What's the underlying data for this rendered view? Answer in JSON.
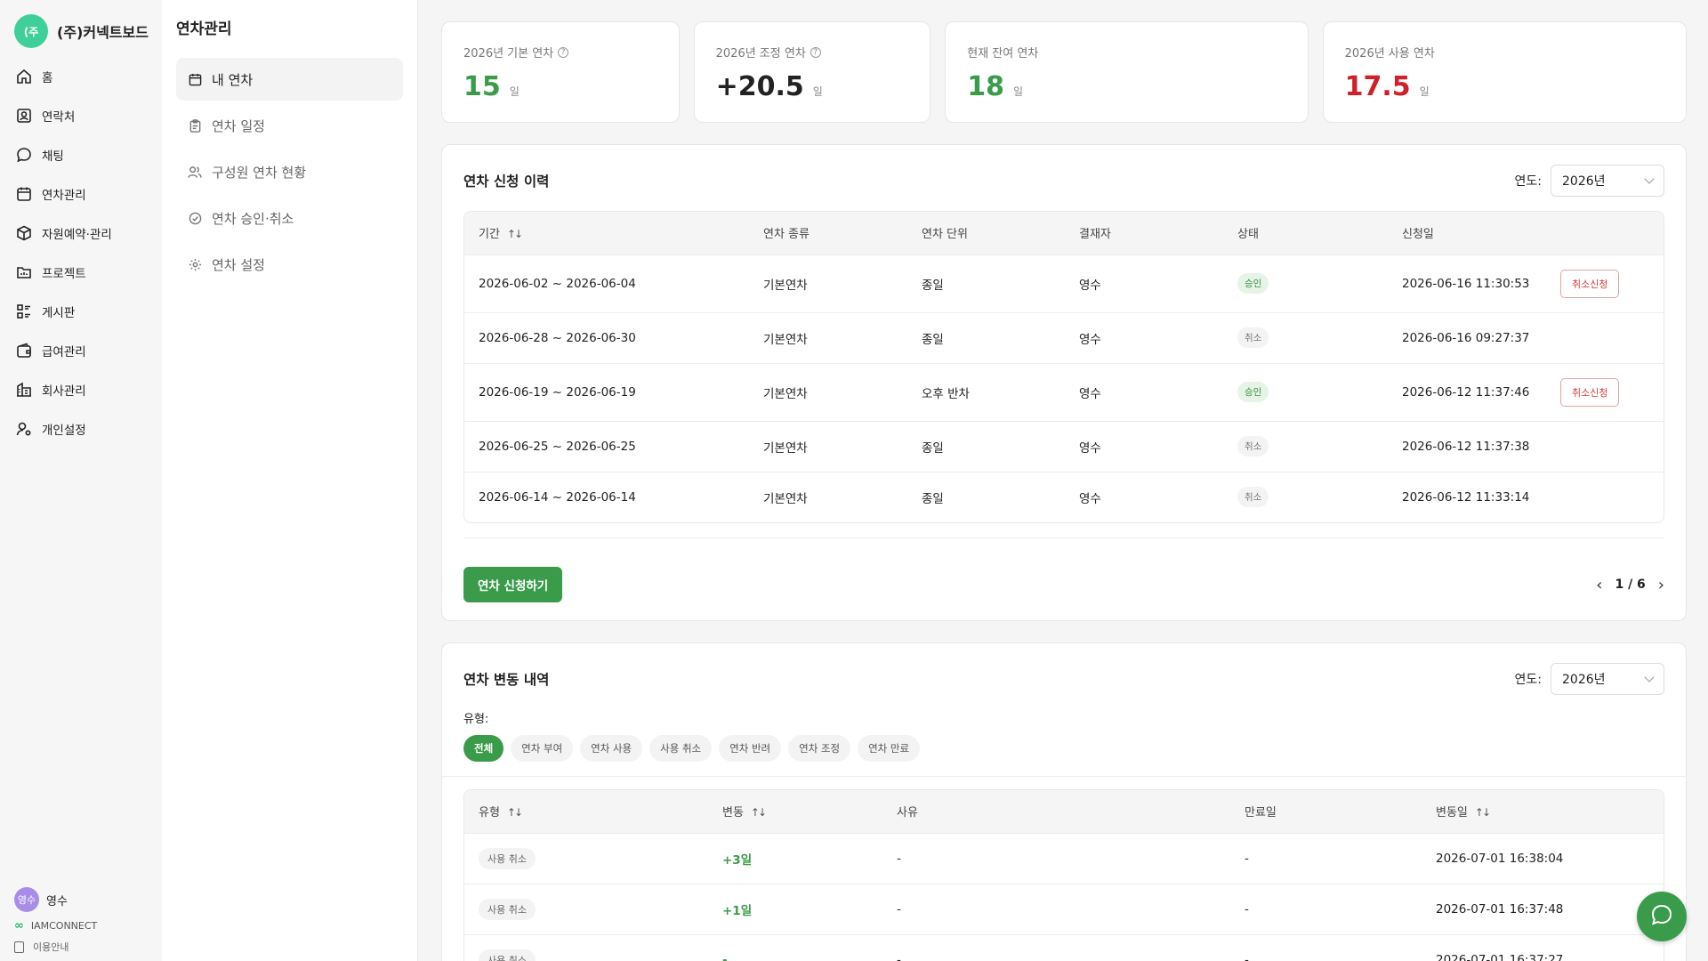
{
  "brand": {
    "logo_text": "(주",
    "name": "(주)커넥트보드"
  },
  "sidebar": {
    "items": [
      {
        "label": "홈",
        "icon": "home-icon"
      },
      {
        "label": "연락처",
        "icon": "contact-icon"
      },
      {
        "label": "채팅",
        "icon": "chat-icon"
      },
      {
        "label": "연차관리",
        "icon": "calendar-icon"
      },
      {
        "label": "자원예약·관리",
        "icon": "box-icon"
      },
      {
        "label": "프로젝트",
        "icon": "folder-icon"
      },
      {
        "label": "게시판",
        "icon": "board-icon"
      },
      {
        "label": "급여관리",
        "icon": "wallet-icon"
      },
      {
        "label": "회사관리",
        "icon": "building-icon"
      },
      {
        "label": "개인설정",
        "icon": "user-settings-icon"
      }
    ],
    "user": {
      "avatar": "영수",
      "name": "영수"
    },
    "iam": "IAMCONNECT",
    "help": "이용안내"
  },
  "submenu": {
    "title": "연차관리",
    "items": [
      {
        "label": "내 연차",
        "icon": "calendar-icon",
        "active": true
      },
      {
        "label": "연차 일정",
        "icon": "clipboard-icon"
      },
      {
        "label": "구성원 연차 현황",
        "icon": "users-icon"
      },
      {
        "label": "연차 승인·취소",
        "icon": "check-circle-icon"
      },
      {
        "label": "연차 설정",
        "icon": "gear-icon"
      }
    ]
  },
  "stats": [
    {
      "label": "2026년 기본 연차",
      "value": "15",
      "unit": "일",
      "color": "#3a9c4a",
      "help": true
    },
    {
      "label": "2026년 조정 연차",
      "value": "+20.5",
      "unit": "일",
      "color": "#222222",
      "help": true
    },
    {
      "label": "현재 잔여 연차",
      "value": "18",
      "unit": "일",
      "color": "#3a9c4a",
      "help": false
    },
    {
      "label": "2026년 사용 연차",
      "value": "17.5",
      "unit": "일",
      "color": "#d0202a",
      "help": false
    }
  ],
  "history": {
    "title": "연차 신청 이력",
    "year_label": "연도:",
    "year": "2026년",
    "columns": [
      "기간",
      "연차 종류",
      "연차 단위",
      "결재자",
      "상태",
      "신청일"
    ],
    "rows": [
      {
        "period": "2026-06-02 ~ 2026-06-04",
        "type": "기본연차",
        "unit": "종일",
        "approver": "영수",
        "status": "승인",
        "date": "2026-06-16 11:30:53",
        "action": "취소신청"
      },
      {
        "period": "2026-06-28 ~ 2026-06-30",
        "type": "기본연차",
        "unit": "종일",
        "approver": "영수",
        "status": "취소",
        "date": "2026-06-16 09:27:37",
        "action": ""
      },
      {
        "period": "2026-06-19 ~ 2026-06-19",
        "type": "기본연차",
        "unit": "오후 반차",
        "approver": "영수",
        "status": "승인",
        "date": "2026-06-12 11:37:46",
        "action": "취소신청"
      },
      {
        "period": "2026-06-25 ~ 2026-06-25",
        "type": "기본연차",
        "unit": "종일",
        "approver": "영수",
        "status": "취소",
        "date": "2026-06-12 11:37:38",
        "action": ""
      },
      {
        "period": "2026-06-14 ~ 2026-06-14",
        "type": "기본연차",
        "unit": "종일",
        "approver": "영수",
        "status": "취소",
        "date": "2026-06-12 11:33:14",
        "action": ""
      }
    ],
    "apply_label": "연차 신청하기",
    "page": "1 / 6"
  },
  "changes": {
    "title": "연차 변동 내역",
    "year_label": "연도:",
    "year": "2026년",
    "type_label": "유형:",
    "chips": [
      "전체",
      "연차 부여",
      "연차 사용",
      "사용 취소",
      "연차 반려",
      "연차 조정",
      "연차 만료"
    ],
    "columns": [
      "유형",
      "변동",
      "사유",
      "만료일",
      "변동일"
    ],
    "rows": [
      {
        "type": "사용 취소",
        "change": "+3일",
        "reason": "-",
        "expire": "-",
        "date": "2026-07-01 16:38:04"
      },
      {
        "type": "사용 취소",
        "change": "+1일",
        "reason": "-",
        "expire": "-",
        "date": "2026-07-01 16:37:48"
      },
      {
        "type": "사용 취소",
        "change": "-",
        "reason": "-",
        "expire": "-",
        "date": "2026-07-01 16:37:27"
      }
    ]
  }
}
